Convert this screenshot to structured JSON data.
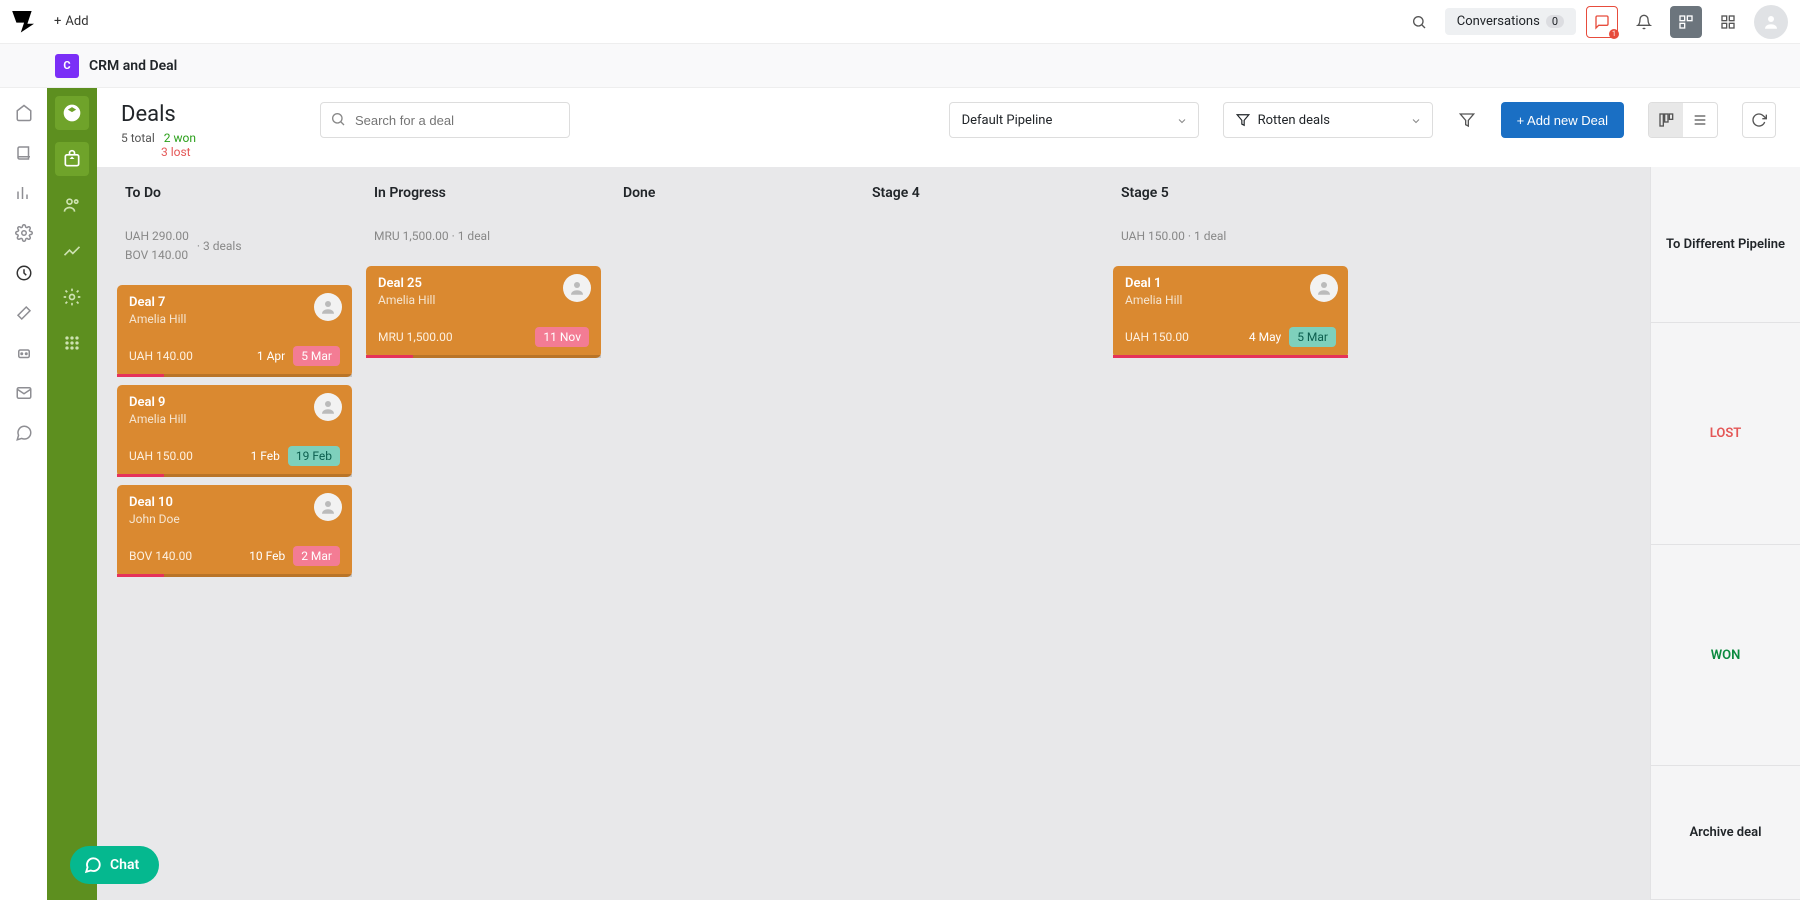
{
  "topbar": {
    "add_label": "Add",
    "conversations_label": "Conversations",
    "conversations_count": "0",
    "chat_badge": "1"
  },
  "titlebar": {
    "module_initial": "C",
    "title": "CRM and Deal"
  },
  "deals_header": {
    "title": "Deals",
    "total_label": "5 total",
    "won_label": "2 won",
    "lost_label": "3 lost",
    "search_placeholder": "Search for a deal",
    "pipeline_label": "Default Pipeline",
    "filter_label": "Rotten deals",
    "add_deal_label": "+ Add new Deal"
  },
  "columns": [
    {
      "title": "To Do",
      "sum_line1": "UAH 290.00",
      "sum_line2": "BOV 140.00",
      "count_label": "· 3 deals",
      "cards": [
        {
          "title": "Deal 7",
          "person": "Amelia Hill",
          "amount": "UAH 140.00",
          "date1": "1 Apr",
          "badge": "5 Mar",
          "badge_style": "red",
          "bar_full": false
        },
        {
          "title": "Deal 9",
          "person": "Amelia Hill",
          "amount": "UAH 150.00",
          "date1": "1 Feb",
          "badge": "19 Feb",
          "badge_style": "green",
          "bar_full": false
        },
        {
          "title": "Deal 10",
          "person": "John Doe",
          "amount": "BOV 140.00",
          "date1": "10 Feb",
          "badge": "2 Mar",
          "badge_style": "red",
          "bar_full": false
        }
      ]
    },
    {
      "title": "In Progress",
      "sum_line1": "MRU 1,500.00 · 1 deal",
      "sum_line2": "",
      "count_label": "",
      "cards": [
        {
          "title": "Deal 25",
          "person": "Amelia Hill",
          "amount": "MRU 1,500.00",
          "date1": "",
          "badge": "11 Nov",
          "badge_style": "red",
          "bar_full": false
        }
      ]
    },
    {
      "title": "Done",
      "sum_line1": "",
      "sum_line2": "",
      "count_label": "",
      "cards": []
    },
    {
      "title": "Stage 4",
      "sum_line1": "",
      "sum_line2": "",
      "count_label": "",
      "cards": []
    },
    {
      "title": "Stage 5",
      "sum_line1": "UAH 150.00 · 1 deal",
      "sum_line2": "",
      "count_label": "",
      "cards": [
        {
          "title": "Deal 1",
          "person": "Amelia Hill",
          "amount": "UAH 150.00",
          "date1": "4 May",
          "badge": "5 Mar",
          "badge_style": "green",
          "bar_full": true
        }
      ]
    }
  ],
  "right_panel": {
    "head": "To Different Pipeline",
    "lost": "LOST",
    "won": "WON",
    "archive": "Archive deal"
  },
  "chat_widget": {
    "label": "Chat"
  }
}
